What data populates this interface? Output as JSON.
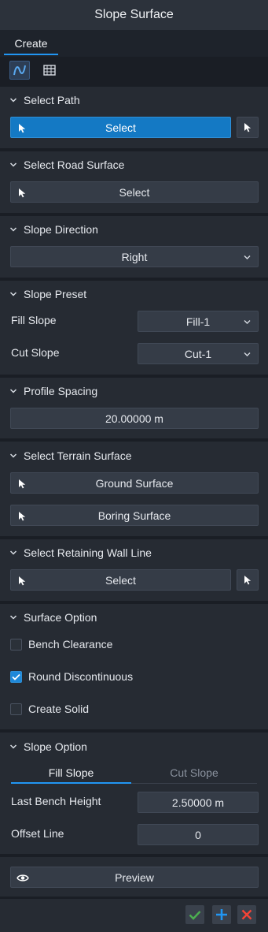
{
  "window": {
    "title": "Slope Surface"
  },
  "tabs": {
    "create": "Create"
  },
  "toolbar": {
    "tool1": "curve-path-icon",
    "tool2": "table-grid-icon"
  },
  "select_path": {
    "title": "Select Path",
    "button": "Select"
  },
  "select_road_surface": {
    "title": "Select Road Surface",
    "button": "Select"
  },
  "slope_direction": {
    "title": "Slope Direction",
    "value": "Right"
  },
  "slope_preset": {
    "title": "Slope Preset",
    "fill_label": "Fill Slope",
    "fill_value": "Fill-1",
    "cut_label": "Cut Slope",
    "cut_value": "Cut-1"
  },
  "profile_spacing": {
    "title": "Profile Spacing",
    "value": "20.00000 m"
  },
  "select_terrain_surface": {
    "title": "Select Terrain Surface",
    "ground": "Ground Surface",
    "boring": "Boring Surface"
  },
  "select_retaining_wall_line": {
    "title": "Select Retaining Wall Line",
    "button": "Select"
  },
  "surface_option": {
    "title": "Surface Option",
    "bench_clearance": "Bench Clearance",
    "bench_clearance_checked": false,
    "round_discontinuous": "Round Discontinuous",
    "round_discontinuous_checked": true,
    "create_solid": "Create Solid",
    "create_solid_checked": false
  },
  "slope_option": {
    "title": "Slope Option",
    "tab_fill": "Fill Slope",
    "tab_cut": "Cut Slope",
    "last_bench_label": "Last Bench Height",
    "last_bench_value": "2.50000 m",
    "offset_label": "Offset Line",
    "offset_value": "0"
  },
  "preview": {
    "button": "Preview"
  },
  "colors": {
    "accent": "#2196f3",
    "primary_button": "#1479c4",
    "ok_green": "#4caf50",
    "add_blue": "#2196f3",
    "cancel_red": "#f44336"
  }
}
